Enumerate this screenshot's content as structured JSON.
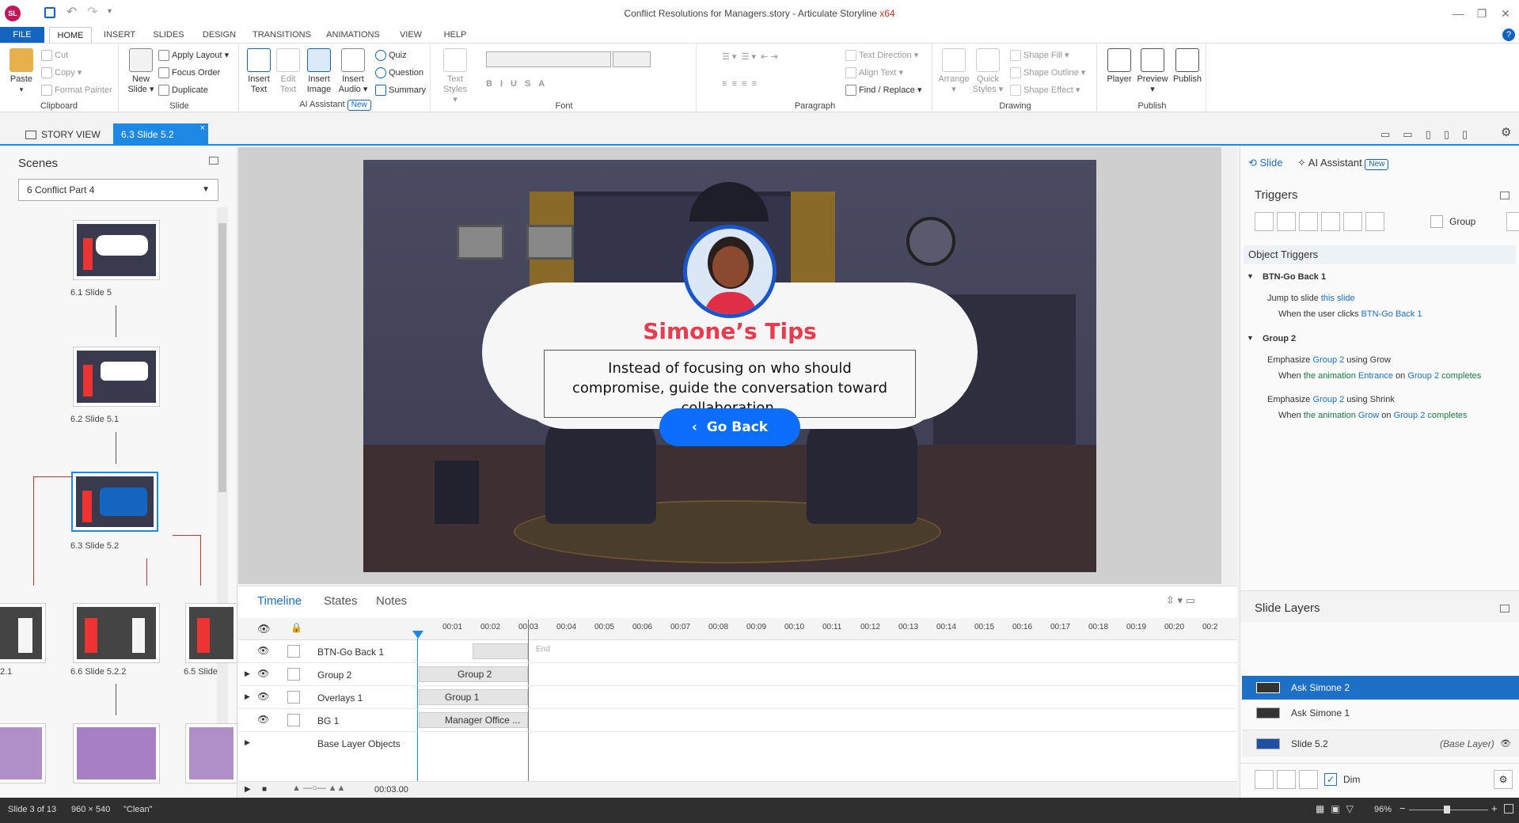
{
  "window": {
    "title": "Conflict Resolutions for Managers.story - Articulate Storyline",
    "badge": "x64",
    "logo": "SL"
  },
  "menu": [
    "FILE",
    "HOME",
    "INSERT",
    "SLIDES",
    "DESIGN",
    "TRANSITIONS",
    "ANIMATIONS",
    "VIEW",
    "HELP"
  ],
  "ribbon": {
    "clipboard": {
      "paste": "Paste",
      "cut": "Cut",
      "copy": "Copy",
      "format_painter": "Format Painter",
      "label": "Clipboard"
    },
    "slide": {
      "new_slide": "New Slide",
      "apply_layout": "Apply Layout",
      "focus_order": "Focus Order",
      "duplicate": "Duplicate",
      "label": "Slide"
    },
    "ai": {
      "insert_text": "Insert Text",
      "edit_text": "Edit Text",
      "insert_image": "Insert Image",
      "insert_audio": "Insert Audio",
      "quiz": "Quiz",
      "question": "Question",
      "summary": "Summary",
      "label": "AI Assistant",
      "new": "New"
    },
    "font": {
      "text_styles": "Text Styles",
      "label": "Font"
    },
    "paragraph": {
      "text_direction": "Text Direction",
      "align_text": "Align Text",
      "find_replace": "Find / Replace",
      "label": "Paragraph"
    },
    "drawing": {
      "arrange": "Arrange",
      "quick_styles": "Quick Styles",
      "shape_fill": "Shape Fill",
      "shape_outline": "Shape Outline",
      "shape_effect": "Shape Effect",
      "label": "Drawing"
    },
    "publish": {
      "player": "Player",
      "preview": "Preview",
      "publish": "Publish",
      "label": "Publish"
    }
  },
  "tabs": {
    "story_view": "STORY VIEW",
    "current": "6.3 Slide 5.2"
  },
  "scenes": {
    "title": "Scenes",
    "selected": "6 Conflict Part 4",
    "labels": {
      "s61": "6.1 Slide 5",
      "s62": "6.2 Slide 5.1",
      "s63": "6.3 Slide 5.2",
      "s64": "2.1",
      "s66": "6.6 Slide 5.2.2",
      "s65": "6.5 Slide"
    }
  },
  "slide": {
    "heading": "Simone’s Tips",
    "body": "Instead of focusing on who should compromise, guide the conversation toward collaboration.",
    "button": "Go Back"
  },
  "timeline": {
    "tabs": [
      "Timeline",
      "States",
      "Notes"
    ],
    "ticks": [
      "00:01",
      "00:02",
      "00:03",
      "00:04",
      "00:05",
      "00:06",
      "00:07",
      "00:08",
      "00:09",
      "00:10",
      "00:11",
      "00:12",
      "00:13",
      "00:14",
      "00:15",
      "00:16",
      "00:17",
      "00:18",
      "00:19",
      "00:20",
      "00:2"
    ],
    "rows": [
      {
        "name": "BTN-Go Back 1",
        "bar": ""
      },
      {
        "name": "Group 2",
        "bar": "Group 2"
      },
      {
        "name": "Overlays 1",
        "bar": "Group 1"
      },
      {
        "name": "BG 1",
        "bar": "Manager Office ..."
      },
      {
        "name": "Base Layer Objects",
        "bar": ""
      }
    ],
    "end": "End",
    "time": "00:03.00"
  },
  "right": {
    "tab_slide": "Slide",
    "tab_ai": "AI Assistant",
    "tab_ai_new": "New",
    "triggers": "Triggers",
    "group": "Group",
    "object_triggers": "Object Triggers",
    "t1": {
      "head": "BTN-Go Back 1",
      "a1": "Jump to slide",
      "a2": "this slide",
      "b1": "When the user clicks",
      "b2": "BTN-Go Back 1"
    },
    "t2": {
      "head": "Group 2",
      "e1a": "Emphasize",
      "e1b": "Group 2",
      "e1c": "using Grow",
      "w1a": "When",
      "w1b": "the animation",
      "w1c": "Entrance",
      "w1d": "on",
      "w1e": "Group 2",
      "w1f": "completes",
      "e2a": "Emphasize",
      "e2b": "Group 2",
      "e2c": "using Shrink",
      "w2a": "When",
      "w2b": "the animation",
      "w2c": "Grow",
      "w2d": "on",
      "w2e": "Group 2",
      "w2f": "completes"
    },
    "layers_title": "Slide Layers",
    "layers": [
      {
        "name": "Ask Simone 2"
      },
      {
        "name": "Ask Simone 1"
      },
      {
        "name": "Slide 5.2",
        "tag": "(Base Layer)"
      }
    ],
    "dim": "Dim"
  },
  "status": {
    "slide": "Slide 3 of 13",
    "size": "960 × 540",
    "state": "\"Clean\"",
    "zoom": "96%"
  },
  "colors": {
    "accent": "#1e88e5",
    "selected_layer": "#1e6fc6",
    "heading": "#e83c4e",
    "go_back": "#0d6efd"
  }
}
